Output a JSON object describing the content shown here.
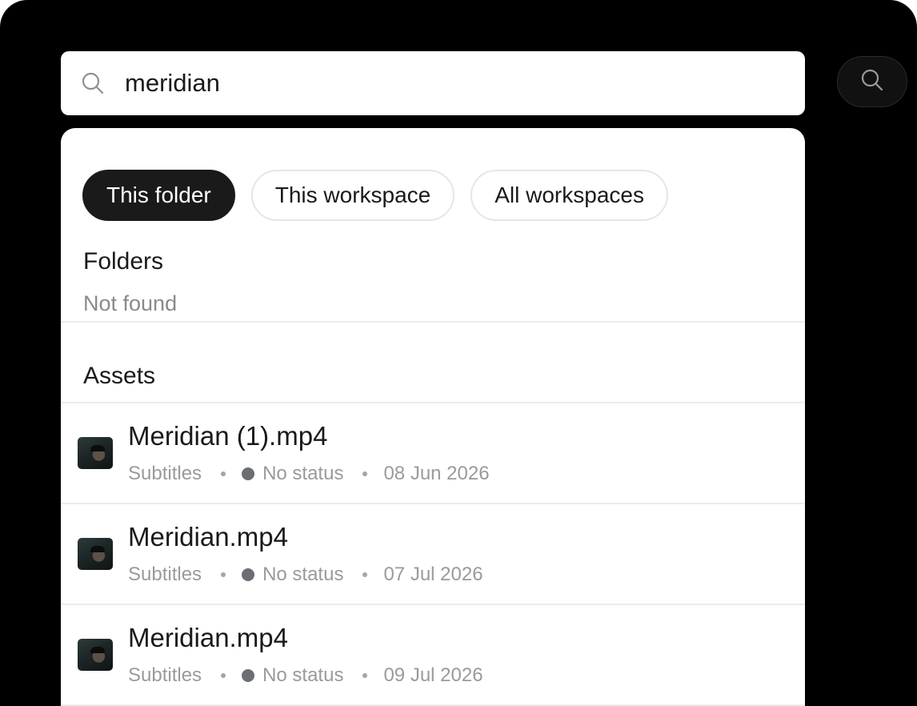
{
  "search": {
    "query": "meridian"
  },
  "scope_tabs": [
    {
      "label": "This folder",
      "active": true
    },
    {
      "label": "This workspace",
      "active": false
    },
    {
      "label": "All workspaces",
      "active": false
    }
  ],
  "folders": {
    "title": "Folders",
    "empty_text": "Not found"
  },
  "assets": {
    "title": "Assets",
    "items": [
      {
        "name": "Meridian (1).mp4",
        "type": "Subtitles",
        "status": "No status",
        "date": "08 Jun 2026",
        "thumbnail_icon": "video-thumbnail"
      },
      {
        "name": "Meridian.mp4",
        "type": "Subtitles",
        "status": "No status",
        "date": "07 Jul 2026",
        "thumbnail_icon": "video-thumbnail"
      },
      {
        "name": "Meridian.mp4",
        "type": "Subtitles",
        "status": "No status",
        "date": "09 Jul 2026",
        "thumbnail_icon": "video-thumbnail"
      }
    ]
  },
  "colors": {
    "active_chip": "#1a1a1a",
    "status_dot": "#6b6f73",
    "muted_text": "#9a9a9a",
    "frame_background": "#000000"
  }
}
